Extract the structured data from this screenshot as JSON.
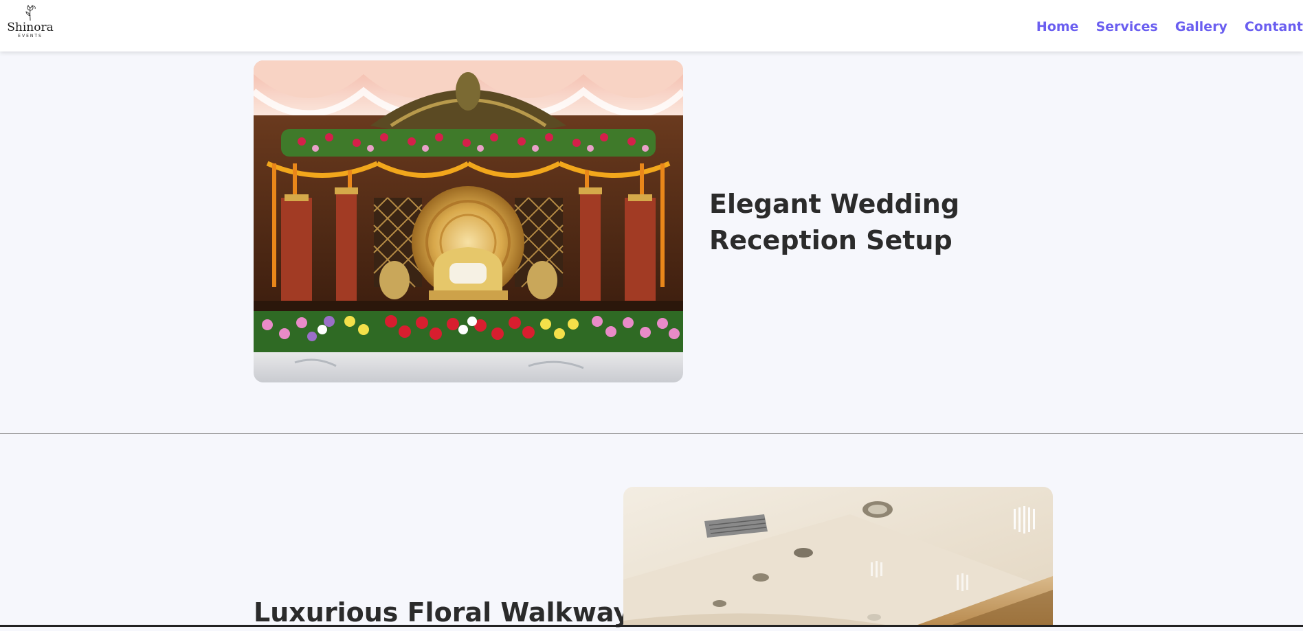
{
  "header": {
    "logo": {
      "name": "Shinora",
      "subtitle": "EVENTS"
    },
    "nav": {
      "home": "Home",
      "services": "Services",
      "gallery": "Gallery",
      "contact": "Contant"
    },
    "nav_color": "#6a5ef0"
  },
  "sections": [
    {
      "title": "Elegant Wedding Reception Setup",
      "image": "wedding-stage-photo"
    },
    {
      "title": "Luxurious Floral Walkway",
      "image": "hall-ceiling-photo"
    }
  ],
  "colors": {
    "background": "#f6f7fc",
    "header_bg": "#ffffff",
    "title_text": "#2b2b2b"
  }
}
